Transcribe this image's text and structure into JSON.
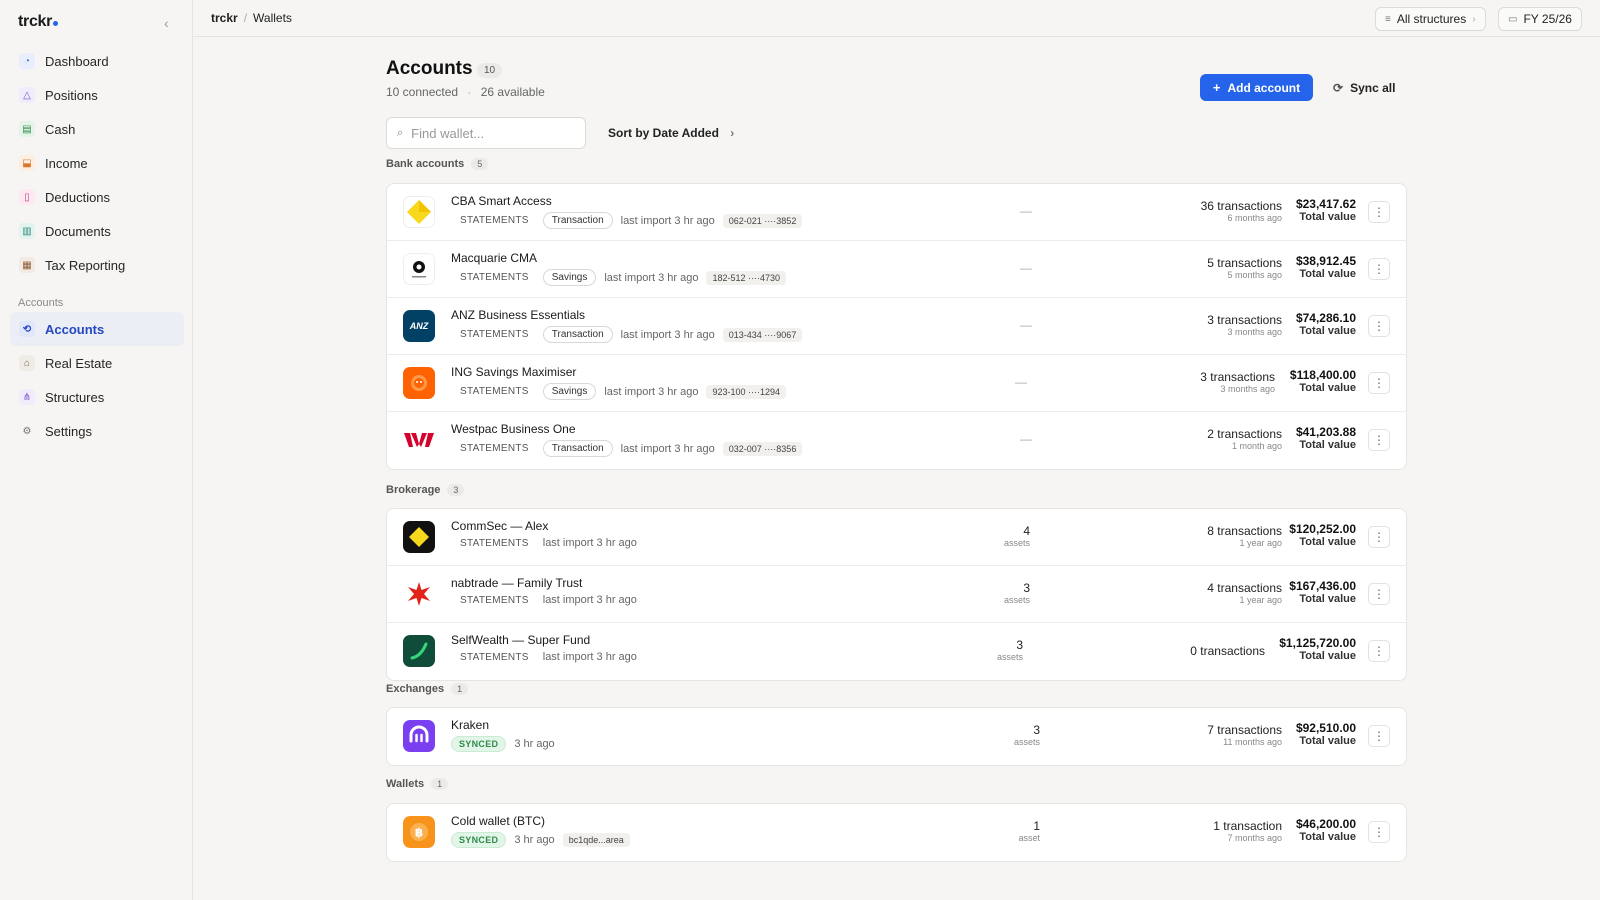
{
  "app": {
    "brand": "trckr"
  },
  "breadcrumb": {
    "root": "trckr",
    "current": "Wallets"
  },
  "topbar": {
    "structures_label": "All structures",
    "fy_label": "FY 25/26"
  },
  "sidebar": {
    "items": [
      {
        "label": "Dashboard",
        "icon": "dashboard-icon"
      },
      {
        "label": "Positions",
        "icon": "positions-icon"
      },
      {
        "label": "Cash",
        "icon": "cash-icon"
      },
      {
        "label": "Income",
        "icon": "income-icon"
      },
      {
        "label": "Deductions",
        "icon": "deductions-icon"
      },
      {
        "label": "Documents",
        "icon": "documents-icon"
      },
      {
        "label": "Tax Reporting",
        "icon": "tax-reporting-icon"
      }
    ],
    "section_label": "Accounts",
    "section_items": [
      {
        "label": "Accounts",
        "icon": "accounts-icon",
        "active": true
      },
      {
        "label": "Real Estate",
        "icon": "real-estate-icon"
      },
      {
        "label": "Structures",
        "icon": "structures-icon"
      },
      {
        "label": "Settings",
        "icon": "settings-icon"
      }
    ]
  },
  "header": {
    "title": "Accounts",
    "count": "10",
    "connected": "10 connected",
    "available": "26 available",
    "add_label": "Add account",
    "sync_label": "Sync all"
  },
  "search": {
    "placeholder": "Find wallet..."
  },
  "sort": {
    "label": "Sort by Date Added"
  },
  "sections": {
    "bank": {
      "label": "Bank accounts",
      "count": "5",
      "rows": [
        {
          "name": "CBA Smart Access",
          "kind": "STATEMENTS",
          "tag": "Transaction",
          "import": "last import 3 hr ago",
          "acct": "062-021 ····3852",
          "dash": "—",
          "tx": "36 transactions",
          "tx_date": "6 months ago",
          "value": "$23,417.62",
          "value_label": "Total value"
        },
        {
          "name": "Macquarie CMA",
          "kind": "STATEMENTS",
          "tag": "Savings",
          "import": "last import 3 hr ago",
          "acct": "182-512 ····4730",
          "dash": "—",
          "tx": "5 transactions",
          "tx_date": "5 months ago",
          "value": "$38,912.45",
          "value_label": "Total value"
        },
        {
          "name": "ANZ Business Essentials",
          "kind": "STATEMENTS",
          "tag": "Transaction",
          "import": "last import 3 hr ago",
          "acct": "013-434 ····9067",
          "dash": "—",
          "tx": "3 transactions",
          "tx_date": "3 months ago",
          "value": "$74,286.10",
          "value_label": "Total value"
        },
        {
          "name": "ING Savings Maximiser",
          "kind": "STATEMENTS",
          "tag": "Savings",
          "import": "last import 3 hr ago",
          "acct": "923-100 ····1294",
          "dash": "—",
          "tx": "3 transactions",
          "tx_date": "3 months ago",
          "value": "$118,400.00",
          "value_label": "Total value"
        },
        {
          "name": "Westpac Business One",
          "kind": "STATEMENTS",
          "tag": "Transaction",
          "import": "last import 3 hr ago",
          "acct": "032-007 ····8356",
          "dash": "—",
          "tx": "2 transactions",
          "tx_date": "1 month ago",
          "value": "$41,203.88",
          "value_label": "Total value"
        }
      ]
    },
    "brokerage": {
      "label": "Brokerage",
      "count": "3",
      "rows": [
        {
          "name": "CommSec — Alex",
          "kind": "STATEMENTS",
          "import": "last import 3 hr ago",
          "assets": "4",
          "assets_label": "assets",
          "tx": "8 transactions",
          "tx_date": "1 year ago",
          "value": "$120,252.00",
          "value_label": "Total value"
        },
        {
          "name": "nabtrade — Family Trust",
          "kind": "STATEMENTS",
          "import": "last import 3 hr ago",
          "assets": "3",
          "assets_label": "assets",
          "tx": "4 transactions",
          "tx_date": "1 year ago",
          "value": "$167,436.00",
          "value_label": "Total value"
        },
        {
          "name": "SelfWealth — Super Fund",
          "kind": "STATEMENTS",
          "import": "last import 3 hr ago",
          "assets": "3",
          "assets_label": "assets",
          "tx": "0 transactions",
          "tx_date": "",
          "value": "$1,125,720.00",
          "value_label": "Total value"
        }
      ]
    },
    "exchanges": {
      "label": "Exchanges",
      "count": "1",
      "rows": [
        {
          "name": "Kraken",
          "status": "SYNCED",
          "import": "3 hr ago",
          "assets": "3",
          "assets_label": "assets",
          "tx": "7 transactions",
          "tx_date": "11 months ago",
          "value": "$92,510.00",
          "value_label": "Total value"
        }
      ]
    },
    "wallets": {
      "label": "Wallets",
      "count": "1",
      "rows": [
        {
          "name": "Cold wallet (BTC)",
          "status": "SYNCED",
          "import": "3 hr ago",
          "acct": "bc1qde...area",
          "assets": "1",
          "assets_label": "asset",
          "tx": "1 transaction",
          "tx_date": "7 months ago",
          "value": "$46,200.00",
          "value_label": "Total value"
        }
      ]
    }
  },
  "colors": {
    "accent": "#2563eb",
    "synced": "#2f8a4c"
  }
}
